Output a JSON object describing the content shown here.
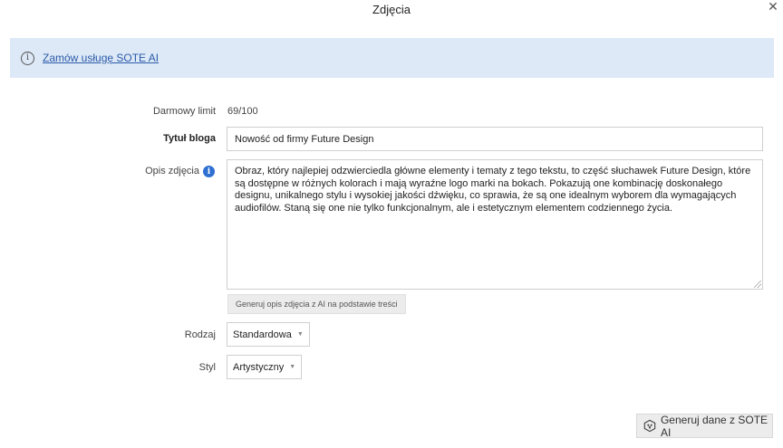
{
  "dialog": {
    "title": "Zdjęcia",
    "close_glyph": "✕"
  },
  "banner": {
    "icon": "info-icon",
    "link_text": "Zamów usługę SOTE AI"
  },
  "form": {
    "limit": {
      "label": "Darmowy limit",
      "value": "69/100"
    },
    "blog_title": {
      "label": "Tytuł bloga",
      "value": "Nowość od firmy Future Design"
    },
    "description": {
      "label": "Opis zdjęcia",
      "help_icon": "info-filled-icon",
      "value": "Obraz, który najlepiej odzwierciedla główne elementy i tematy z tego tekstu, to część słuchawek Future Design, które są dostępne w różnych kolorach i mają wyraźne logo marki na bokach. Pokazują one kombinację doskonałego designu, unikalnego stylu i wysokiej jakości dźwięku, co sprawia, że są one idealnym wyborem dla wymagających audiofilów. Staną się one nie tylko funkcjonalnym, ale i estetycznym elementem codziennego życia.",
      "generate_button": "Generuj opis zdjęcia z AI na podstawie treści"
    },
    "type": {
      "label": "Rodzaj",
      "selected": "Standardowa"
    },
    "style": {
      "label": "Styl",
      "selected": "Artystyczny"
    }
  },
  "footer": {
    "generate_button": "Generuj dane z SOTE AI",
    "icon": "ai-brain-icon"
  },
  "colors": {
    "banner_bg": "#dde9f7",
    "link": "#2b5aa8",
    "help_icon": "#2f6fd1"
  }
}
